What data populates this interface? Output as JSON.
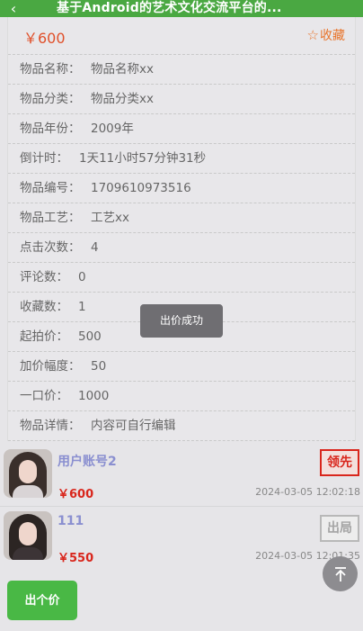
{
  "header": {
    "back_icon": "back-arrow-icon",
    "title": "基于Android的艺术文化交流平台的..."
  },
  "product": {
    "price": "￥600",
    "favorite_label": "收藏",
    "fields": [
      {
        "label": "物品名称：",
        "value": "物品名称xx"
      },
      {
        "label": "物品分类：",
        "value": "物品分类xx"
      },
      {
        "label": "物品年份：",
        "value": "2009年"
      },
      {
        "label": "倒计时：",
        "value": "1天11小时57分钟31秒"
      },
      {
        "label": "物品编号：",
        "value": "1709610973516"
      },
      {
        "label": "物品工艺：",
        "value": "工艺xx"
      },
      {
        "label": "点击次数：",
        "value": "4"
      },
      {
        "label": "评论数：",
        "value": "0"
      },
      {
        "label": "收藏数：",
        "value": "1"
      },
      {
        "label": "起拍价：",
        "value": "500"
      },
      {
        "label": "加价幅度：",
        "value": "50"
      },
      {
        "label": "一口价：",
        "value": "1000"
      },
      {
        "label": "物品详情：",
        "value": "内容可自行编辑"
      }
    ]
  },
  "toast": "出价成功",
  "bids": [
    {
      "user": "用户账号2",
      "price": "￥600",
      "date": "2024-03-05 12:02:18",
      "status": "领先"
    },
    {
      "user": "111",
      "price": "￥550",
      "date": "2024-03-05 12:01:35",
      "status": "出局"
    }
  ],
  "actions": {
    "bid_button": "出个价",
    "back_to_top_icon": "arrow-up-icon"
  },
  "colors": {
    "header": "#4aa842",
    "price": "#e0502a",
    "bid_price": "#d9261c",
    "username": "#8a8fd0",
    "button": "#49b845"
  }
}
